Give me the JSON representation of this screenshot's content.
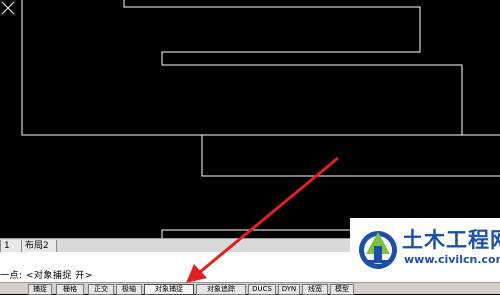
{
  "layout_tabs": [
    "1",
    "布局2"
  ],
  "command_line": {
    "prompt_text": "一点: <对象捕捉 开>"
  },
  "status_bar": {
    "buttons": [
      "捕捉",
      "栅格",
      "正交",
      "极轴",
      "对象捕捉",
      "对象追踪",
      "DUCS",
      "DYN",
      "线宽",
      "模型"
    ]
  },
  "watermark": {
    "title": "土木工程网",
    "url": "www.civilcn.com"
  },
  "colors": {
    "canvas_bg": "#000000",
    "drawing_line": "#ffffff",
    "arrow": "#e02020",
    "watermark_blue": "#1c4fa8"
  }
}
